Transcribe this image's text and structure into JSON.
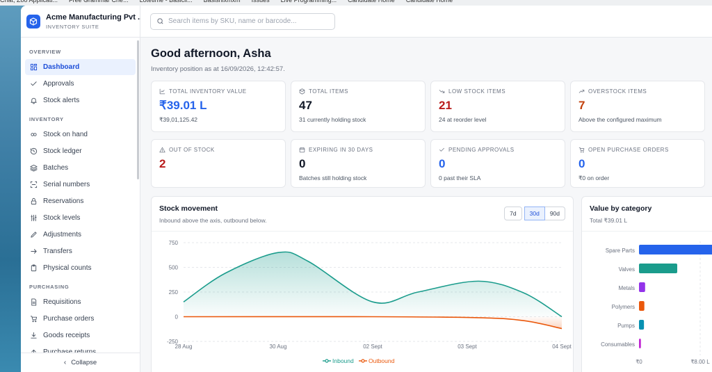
{
  "browser": {
    "bookmarks": [
      "Chat, Zoo Applicati...",
      "Free Grammar Che...",
      "Lotetime - Basicii...",
      "Basisnixmxm",
      "Issues",
      "Live Programming...",
      "Candidate Home",
      "Candidate Home"
    ]
  },
  "brand": {
    "name": "Acme Manufacturing Pvt ...",
    "subtitle": "INVENTORY SUITE"
  },
  "sidebar": {
    "sections": [
      {
        "title": "OVERVIEW",
        "items": [
          {
            "label": "Dashboard",
            "icon": "dashboard-icon",
            "active": true
          },
          {
            "label": "Approvals",
            "icon": "check-icon"
          },
          {
            "label": "Stock alerts",
            "icon": "bell-icon"
          }
        ]
      },
      {
        "title": "INVENTORY",
        "items": [
          {
            "label": "Stock on hand",
            "icon": "link-icon"
          },
          {
            "label": "Stock ledger",
            "icon": "history-icon"
          },
          {
            "label": "Batches",
            "icon": "layers-icon"
          },
          {
            "label": "Serial numbers",
            "icon": "scan-icon"
          },
          {
            "label": "Reservations",
            "icon": "lock-icon"
          },
          {
            "label": "Stock levels",
            "icon": "sliders-icon"
          },
          {
            "label": "Adjustments",
            "icon": "pencil-icon"
          },
          {
            "label": "Transfers",
            "icon": "arrow-right-icon"
          },
          {
            "label": "Physical counts",
            "icon": "clipboard-icon"
          }
        ]
      },
      {
        "title": "PURCHASING",
        "items": [
          {
            "label": "Requisitions",
            "icon": "document-icon"
          },
          {
            "label": "Purchase orders",
            "icon": "cart-icon"
          },
          {
            "label": "Goods receipts",
            "icon": "download-icon"
          },
          {
            "label": "Purchase returns",
            "icon": "arrow-up-icon"
          }
        ]
      }
    ],
    "collapse_label": "Collapse"
  },
  "search": {
    "placeholder": "Search items by SKU, name or barcode..."
  },
  "greeting": {
    "title": "Good afternoon, Asha",
    "subtitle": "Inventory position as at 16/09/2026, 12:42:57."
  },
  "kpis": [
    {
      "label": "TOTAL INVENTORY VALUE",
      "value": "₹39.01 L",
      "sub": "₹39,01,125.42",
      "color": "#2563eb",
      "icon": "chart-line-icon"
    },
    {
      "label": "TOTAL ITEMS",
      "value": "47",
      "sub": "31 currently holding stock",
      "color": "#111827",
      "icon": "box-icon"
    },
    {
      "label": "LOW STOCK ITEMS",
      "value": "21",
      "sub": "24 at reorder level",
      "color": "#b91c1c",
      "icon": "trend-down-icon"
    },
    {
      "label": "OVERSTOCK ITEMS",
      "value": "7",
      "sub": "Above the configured maximum",
      "color": "#c2410c",
      "icon": "trend-up-icon"
    },
    {
      "label": "OUT OF STOCK",
      "value": "2",
      "sub": "",
      "color": "#b91c1c",
      "icon": "warning-icon"
    },
    {
      "label": "EXPIRING IN 30 DAYS",
      "value": "0",
      "sub": "Batches still holding stock",
      "color": "#111827",
      "icon": "calendar-icon"
    },
    {
      "label": "PENDING APPROVALS",
      "value": "0",
      "sub": "0 past their SLA",
      "color": "#2563eb",
      "icon": "check-icon"
    },
    {
      "label": "OPEN PURCHASE ORDERS",
      "value": "0",
      "sub": "₹0 on order",
      "color": "#2563eb",
      "icon": "cart-icon"
    }
  ],
  "stock_movement": {
    "title": "Stock movement",
    "subtitle": "Inbound above the axis, outbound below.",
    "ranges": [
      "7d",
      "30d",
      "90d"
    ],
    "active_range": "30d"
  },
  "value_by_category": {
    "title": "Value by category",
    "subtitle": "Total ₹39.01 L"
  },
  "chart_data": [
    {
      "type": "area",
      "title": "Stock movement",
      "x": [
        "28 Aug",
        "30 Aug",
        "02 Sept",
        "03 Sept",
        "04 Sept"
      ],
      "yticks": [
        "750",
        "500",
        "250",
        "0",
        "-250"
      ],
      "ylim": [
        -250,
        750
      ],
      "series": [
        {
          "name": "Inbound",
          "color": "#1a9c8c",
          "points": [
            [
              0,
              150
            ],
            [
              0.11,
              440
            ],
            [
              0.25,
              650
            ],
            [
              0.33,
              560
            ],
            [
              0.5,
              150
            ],
            [
              0.62,
              250
            ],
            [
              0.78,
              360
            ],
            [
              0.9,
              240
            ],
            [
              1,
              0
            ]
          ]
        },
        {
          "name": "Outbound",
          "color": "#ea580c",
          "points": [
            [
              0,
              0
            ],
            [
              0.5,
              0
            ],
            [
              0.78,
              -10
            ],
            [
              0.9,
              -40
            ],
            [
              1,
              -120
            ]
          ]
        }
      ],
      "grid": true,
      "legend": "bottom"
    },
    {
      "type": "bar",
      "orientation": "horizontal",
      "title": "Value by category",
      "categories": [
        "Spare Parts",
        "Valves",
        "Metals",
        "Polymers",
        "Pumps",
        "Consumables"
      ],
      "values": [
        14.8,
        5.0,
        0.8,
        0.7,
        0.65,
        0.25
      ],
      "colors": [
        "#2563eb",
        "#1a9c8c",
        "#9333ea",
        "#ea580c",
        "#0891b2",
        "#c026d3"
      ],
      "xticks": [
        "₹0",
        "₹8.00 L"
      ]
    }
  ]
}
